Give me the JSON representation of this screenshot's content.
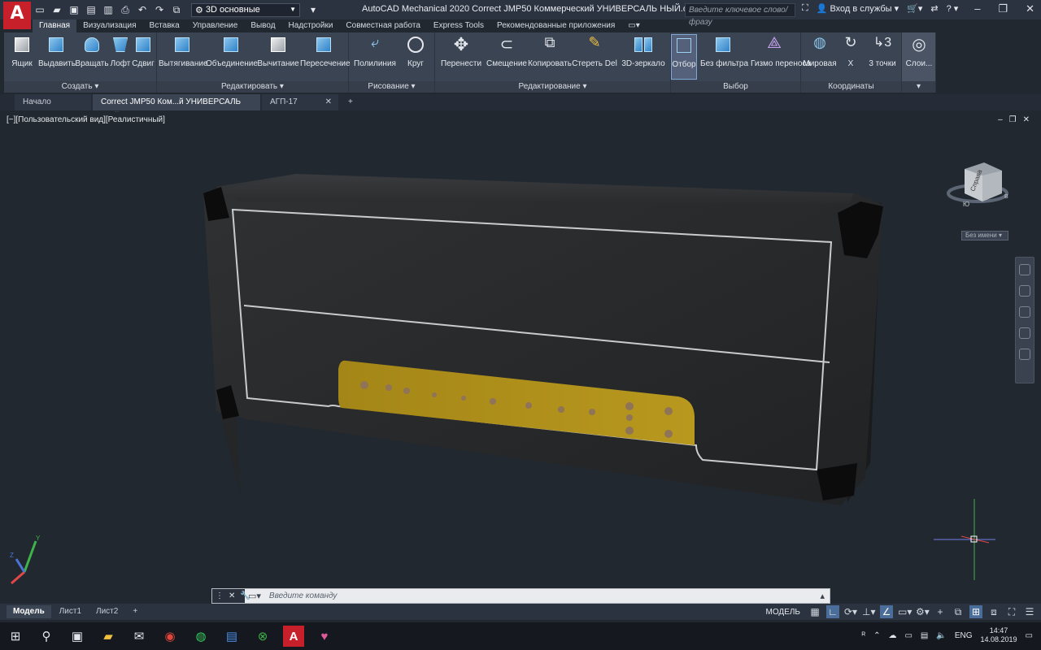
{
  "app": {
    "logo_letter": "A",
    "workspace": "3D основные",
    "window_title": "AutoCAD Mechanical 2020   Correct JMP50 Коммерческий УНИВЕРСАЛЬ НЫЙ.dwg",
    "search_placeholder": "Введите ключевое слово/фразу",
    "signin_label": "Вход в службы",
    "help_label": "?"
  },
  "ribbon_tabs": [
    "Главная",
    "Визуализация",
    "Вставка",
    "Управление",
    "Вывод",
    "Надстройки",
    "Совместная работа",
    "Express Tools",
    "Рекомендованные приложения"
  ],
  "panels": {
    "create": {
      "title": "Создать",
      "tools": [
        "Ящик",
        "Выдавить",
        "Вращать",
        "Лофт",
        "Сдвиг"
      ]
    },
    "edit_solid": {
      "title": "Редактировать",
      "tools": [
        "Вытягивание",
        "Объединение",
        "Вычитание",
        "Пересечение"
      ]
    },
    "draw": {
      "title": "Рисование",
      "tools": [
        "Полилиния",
        "Круг"
      ]
    },
    "modify": {
      "title": "Редактирование",
      "tools": [
        "Перенести",
        "Смещение",
        "Копировать",
        "Стереть Del",
        "3D-зеркало"
      ]
    },
    "select": {
      "title": "Выбор",
      "tools": [
        "Отбор",
        "Без фильтра",
        "Гизмо переноса"
      ]
    },
    "coords": {
      "title": "Координаты",
      "tools": [
        "Мировая",
        "X",
        "3 точки"
      ]
    },
    "layers": {
      "tools": [
        "Слои..."
      ]
    }
  },
  "doc_tabs": [
    {
      "label": "Начало"
    },
    {
      "label": "Correct JMP50 Ком...й УНИВЕРСАЛЬ НЫЙ*"
    },
    {
      "label": "АГП-17"
    }
  ],
  "viewport": {
    "label": "[−][Пользовательский вид][Реалистичный]",
    "viewcube_face": "Справа",
    "compass": {
      "south": "Ю",
      "east": "В"
    },
    "wcs_name": "Без имени"
  },
  "command": {
    "placeholder": "Введите  команду"
  },
  "layout_tabs": [
    "Модель",
    "Лист1",
    "Лист2"
  ],
  "status": {
    "model_label": "МОДЕЛЬ"
  },
  "taskbar": {
    "lang": "ENG",
    "time": "14:47",
    "date": "14.08.2019"
  },
  "colors": {
    "accent": "#c8202a",
    "panel_gold": "#b3941a",
    "tolex": "#2a2b2d"
  }
}
